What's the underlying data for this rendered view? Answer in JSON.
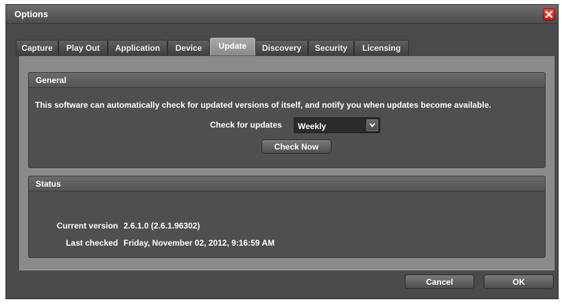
{
  "window": {
    "title": "Options"
  },
  "tabs": [
    {
      "label": "Capture"
    },
    {
      "label": "Play Out"
    },
    {
      "label": "Application"
    },
    {
      "label": "Device"
    },
    {
      "label": "Update",
      "active": true
    },
    {
      "label": "Discovery"
    },
    {
      "label": "Security"
    },
    {
      "label": "Licensing"
    }
  ],
  "general": {
    "header": "General",
    "description": "This software can automatically check for updated versions of itself, and notify you when updates become available.",
    "check_label": "Check for updates",
    "frequency_value": "Weekly",
    "check_now_label": "Check Now"
  },
  "status": {
    "header": "Status",
    "current_version_label": "Current version",
    "current_version_value": "2.6.1.0  (2.6.1.96302)",
    "last_checked_label": "Last checked",
    "last_checked_value": "Friday, November 02, 2012, 9:16:59 AM"
  },
  "footer": {
    "cancel_label": "Cancel",
    "ok_label": "OK"
  },
  "colors": {
    "close_button": "#d9291c",
    "active_tab": "#9a9a9a",
    "panel": "#8a8a8a",
    "group": "#4f4f4f"
  },
  "icons": {
    "close": "close-icon",
    "dropdown": "chevron-down-icon"
  }
}
